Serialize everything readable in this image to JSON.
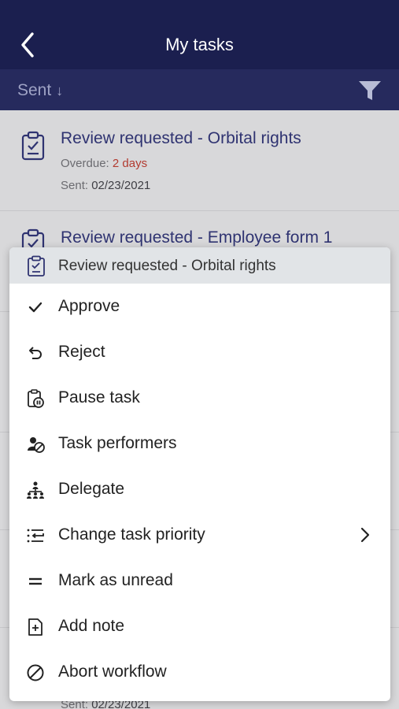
{
  "header": {
    "title": "My tasks"
  },
  "toolbar": {
    "sort_label": "Sent",
    "sort_arrow": "↓"
  },
  "tasks": [
    {
      "title": "Review requested - Orbital rights",
      "overdue_label": "Overdue:",
      "overdue_value": "2 days",
      "sent_label": "Sent:",
      "sent_value": "02/23/2021"
    },
    {
      "title": "Review requested - Employee form 1"
    },
    {
      "sent_label": "Sent:",
      "sent_value": "02/23/2021"
    }
  ],
  "menu": {
    "header_label": "Review requested - Orbital rights",
    "items": [
      {
        "label": "Approve",
        "icon": "check-icon"
      },
      {
        "label": "Reject",
        "icon": "undo-icon"
      },
      {
        "label": "Pause task",
        "icon": "pause-task-icon"
      },
      {
        "label": "Task performers",
        "icon": "performers-icon"
      },
      {
        "label": "Delegate",
        "icon": "hierarchy-icon"
      },
      {
        "label": "Change task priority",
        "icon": "priority-icon"
      },
      {
        "label": "Mark as unread",
        "icon": "equals-icon"
      },
      {
        "label": "Add note",
        "icon": "add-note-icon"
      },
      {
        "label": "Abort workflow",
        "icon": "prohibited-icon"
      }
    ]
  },
  "colors": {
    "header_bg": "#1b1f4f",
    "toolbar_bg": "#262a5d",
    "task_title": "#2f3371",
    "overdue": "#b23b30"
  }
}
